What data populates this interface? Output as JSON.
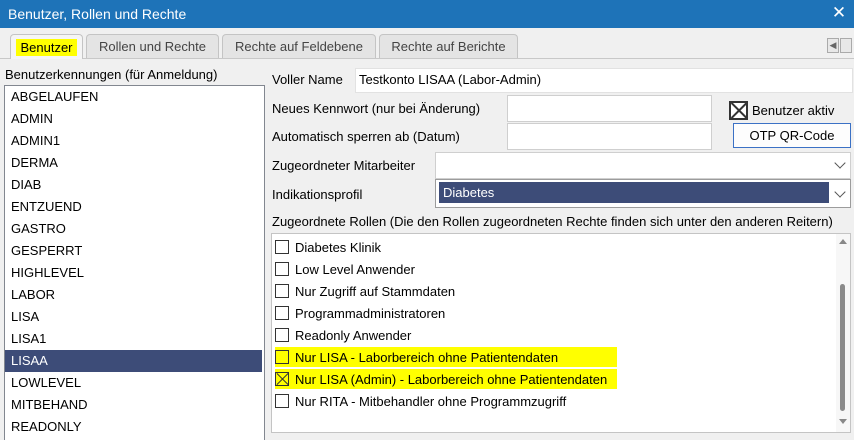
{
  "window": {
    "title": "Benutzer, Rollen und Rechte",
    "close_glyph": "✕"
  },
  "tabs": [
    {
      "label": "Benutzer",
      "active": true,
      "highlighted": true
    },
    {
      "label": "Rollen und Rechte",
      "active": false
    },
    {
      "label": "Rechte auf Feldebene",
      "active": false
    },
    {
      "label": "Rechte auf Berichte",
      "active": false
    }
  ],
  "tab_nav": {
    "prev_glyph": "◀",
    "next_glyph": ""
  },
  "users": {
    "label": "Benutzerkennungen (für Anmeldung)",
    "items": [
      "ABGELAUFEN",
      "ADMIN",
      "ADMIN1",
      "DERMA",
      "DIAB",
      "ENTZUEND",
      "GASTRO",
      "GESPERRT",
      "HIGHLEVEL",
      "LABOR",
      "LISA",
      "LISA1",
      "LISAA",
      "LOWLEVEL",
      "MITBEHAND",
      "READONLY"
    ],
    "selected": "LISAA"
  },
  "form": {
    "voller_name_label": "Voller Name",
    "voller_name_value": "Testkonto LISAA (Labor-Admin)",
    "kennwort_label": "Neues Kennwort (nur bei Änderung)",
    "kennwort_value": "",
    "sperren_label": "Automatisch sperren ab (Datum)",
    "sperren_value": "",
    "aktiv_label": "Benutzer aktiv",
    "aktiv_checked": true,
    "otp_button": "OTP QR-Code",
    "mitarbeiter_label": "Zugeordneter Mitarbeiter",
    "mitarbeiter_value": "",
    "indikation_label": "Indikationsprofil",
    "indikation_value": "Diabetes"
  },
  "roles": {
    "label": "Zugeordnete Rollen (Die den Rollen zugeordneten Rechte finden sich unter den anderen Reitern)",
    "items": [
      {
        "label": "Diabetes Klinik",
        "checked": false,
        "highlighted": false
      },
      {
        "label": "Low Level Anwender",
        "checked": false,
        "highlighted": false
      },
      {
        "label": "Nur Zugriff auf Stammdaten",
        "checked": false,
        "highlighted": false
      },
      {
        "label": "Programmadministratoren",
        "checked": false,
        "highlighted": false
      },
      {
        "label": "Readonly Anwender",
        "checked": false,
        "highlighted": false
      },
      {
        "label": "Nur LISA - Laborbereich ohne Patientendaten",
        "checked": false,
        "highlighted": true
      },
      {
        "label": "Nur LISA (Admin) - Laborbereich ohne Patientendaten",
        "checked": true,
        "highlighted": true
      },
      {
        "label": "Nur RITA - Mitbehandler ohne Programmzugriff",
        "checked": false,
        "highlighted": false
      }
    ]
  },
  "colors": {
    "titlebar": "#1e73b8",
    "selection": "#3d4c78",
    "highlight": "#ffff00",
    "button_border": "#3b71c5"
  }
}
